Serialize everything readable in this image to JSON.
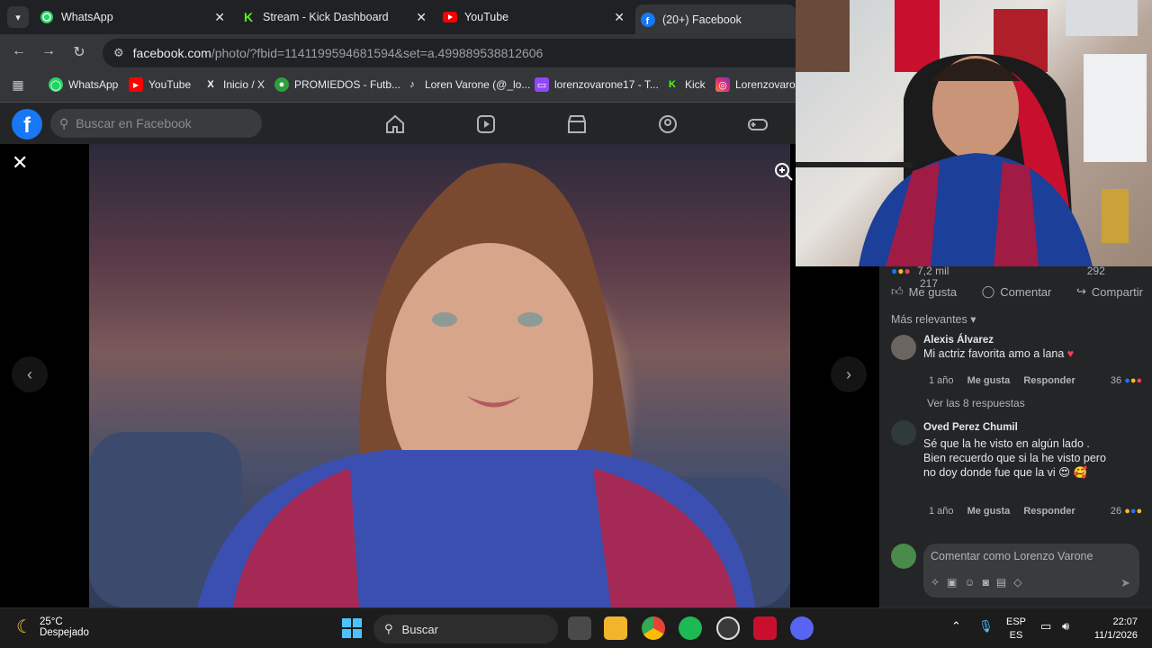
{
  "browser": {
    "tabs": [
      {
        "label": "WhatsApp",
        "close": "✕"
      },
      {
        "label": "Stream - Kick Dashboard",
        "close": "✕"
      },
      {
        "label": "YouTube",
        "close": "✕"
      },
      {
        "label": "(20+) Facebook",
        "close": ""
      }
    ],
    "url_domain": "facebook.com",
    "url_path": "/photo/?fbid=1141199594681594&set=a.499889538812606",
    "bookmarks": [
      {
        "label": "WhatsApp"
      },
      {
        "label": "YouTube"
      },
      {
        "label": "Inicio / X"
      },
      {
        "label": "PROMIEDOS - Futb..."
      },
      {
        "label": "Loren Varone (@_lo..."
      },
      {
        "label": "lorenzovarone17 - T..."
      },
      {
        "label": "Kick"
      },
      {
        "label": "Lorenzovaron"
      }
    ]
  },
  "facebook": {
    "logo": "f",
    "search_placeholder": "Buscar en Facebook",
    "reactions_count": "7,2 mil",
    "comments_count": "292",
    "shares_count": "217",
    "actions": {
      "like": "Me gusta",
      "comment": "Comentar",
      "share": "Compartir"
    },
    "sort_label": "Más relevantes",
    "comments": [
      {
        "name": "Alexis Álvarez",
        "text": "Mi actriz favorita amo a lana",
        "time": "1 año",
        "like": "Me gusta",
        "reply": "Responder",
        "reaction_count": "36"
      },
      {
        "name": "Oved Perez Chumil",
        "text": "Sé que la he visto en algún lado . Bien recuerdo que si la he visto pero no doy donde fue que la vi",
        "time": "1 año",
        "like": "Me gusta",
        "reply": "Responder",
        "reaction_count": "26"
      }
    ],
    "view_replies": "Ver las 8 respuestas",
    "composer_placeholder": "Comentar como Lorenzo Varone"
  },
  "taskbar": {
    "temperature": "25°C",
    "weather": "Despejado",
    "search": "Buscar",
    "lang_top": "ESP",
    "lang_bottom": "ES",
    "time": "22:07",
    "date": "11/1/2026"
  },
  "colors": {
    "fb_blue": "#1877f2",
    "fb_surface": "#242526",
    "chrome_dark": "#202124",
    "chrome_toolbar": "#35363a"
  }
}
